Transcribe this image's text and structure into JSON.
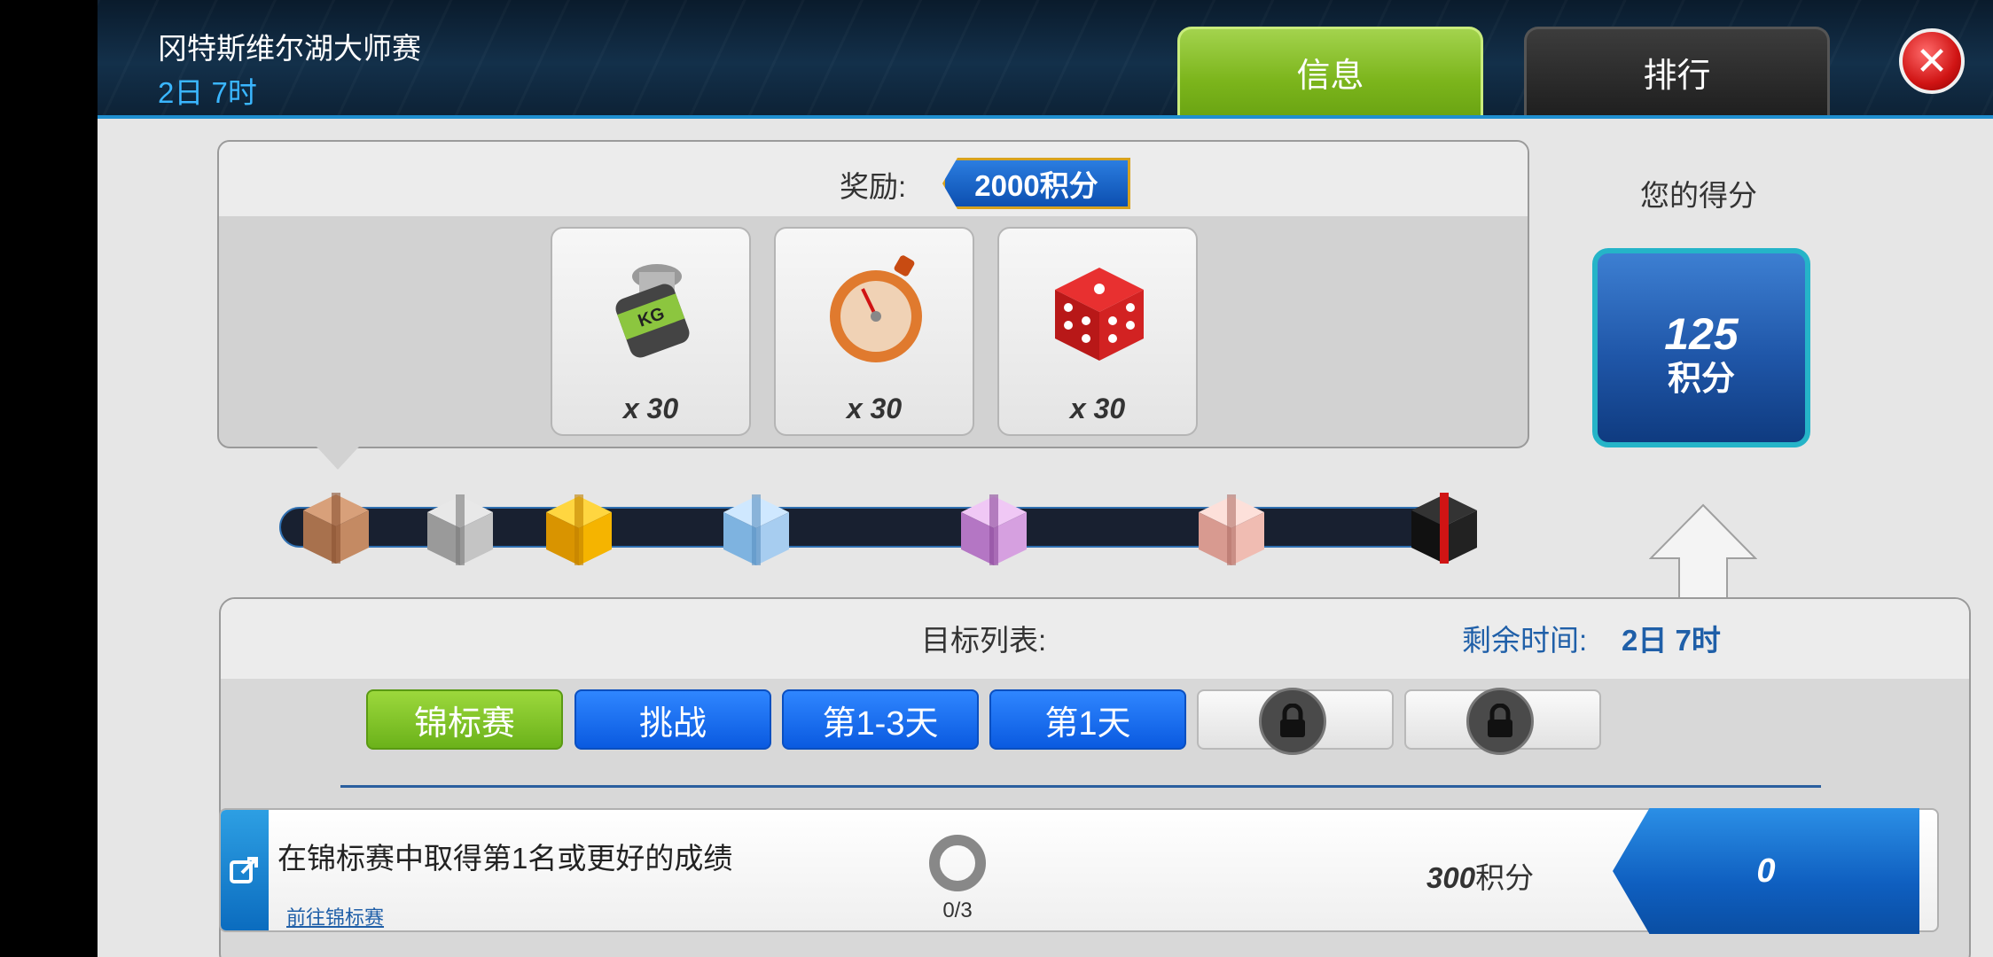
{
  "header": {
    "event_title": "冈特斯维尔湖大师赛",
    "event_timer": "2日 7时",
    "tabs": [
      {
        "label": "信息",
        "active": true
      },
      {
        "label": "排行",
        "active": false
      }
    ],
    "close_icon": "close-icon"
  },
  "reward": {
    "label": "奖励:",
    "badge": "2000积分",
    "items": [
      {
        "icon": "weight-kg-icon",
        "qty": "x 30"
      },
      {
        "icon": "stopwatch-icon",
        "qty": "x 30"
      },
      {
        "icon": "dice-icon",
        "qty": "x 30"
      }
    ]
  },
  "score": {
    "label": "您的得分",
    "value": "125",
    "unit": "积分"
  },
  "progress": {
    "gifts": [
      "gift-bronze-icon",
      "gift-silver-icon",
      "gift-gold-icon",
      "gift-blue-icon",
      "gift-purple-icon",
      "gift-pink-icon",
      "gift-black-icon"
    ]
  },
  "goals": {
    "title": "目标列表:",
    "time_left_label": "剩余时间:",
    "time_left_value": "2日 7时",
    "filters": [
      {
        "label": "锦标赛",
        "state": "active"
      },
      {
        "label": "挑战",
        "state": "blue"
      },
      {
        "label": "第1-3天",
        "state": "blue"
      },
      {
        "label": "第1天",
        "state": "blue"
      },
      {
        "label": "",
        "state": "locked"
      },
      {
        "label": "",
        "state": "locked"
      }
    ],
    "row": {
      "description": "在锦标赛中取得第1名或更好的成绩",
      "link": "前往锦标赛",
      "progress": "0/3",
      "points_number": "300",
      "points_unit": "积分",
      "claim_value": "0"
    }
  }
}
